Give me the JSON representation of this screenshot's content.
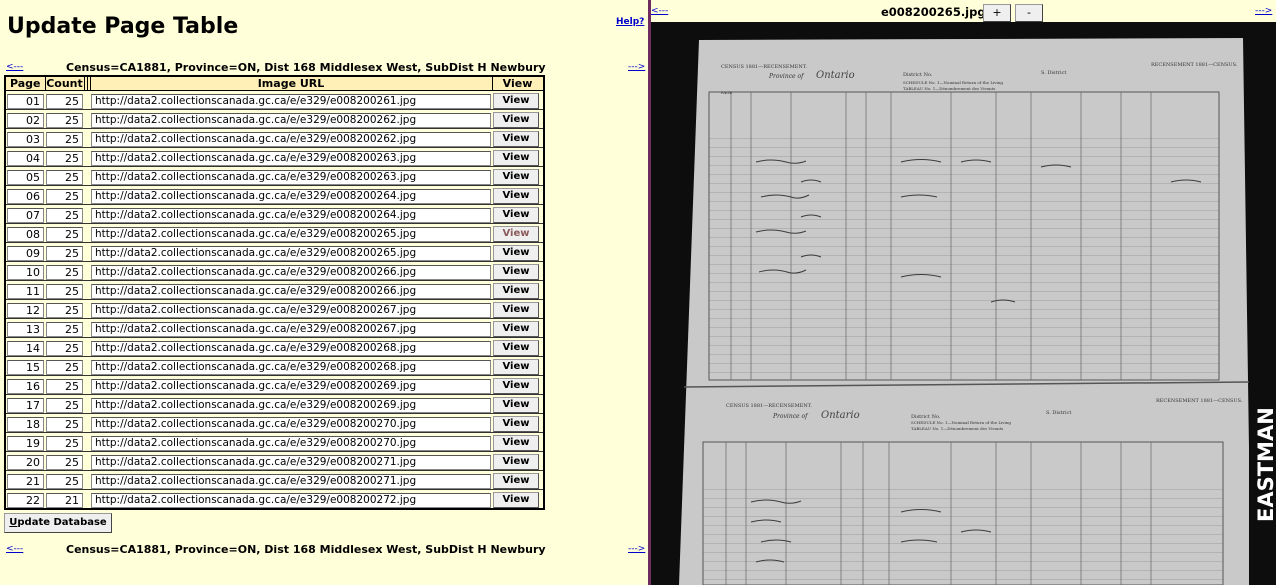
{
  "left": {
    "title": "Update Page Table",
    "help": "Help?",
    "prev": "<---",
    "next": "--->",
    "census": "Census=CA1881, Province=ON, Dist 168 Middlesex West, SubDist H Newbury",
    "headers": {
      "page": "Page",
      "count": "Count",
      "url": "Image URL",
      "view": "View"
    },
    "rows": [
      {
        "page": "01",
        "count": "25",
        "url": "http://data2.collectionscanada.gc.ca/e/e329/e008200261.jpg",
        "view": "View"
      },
      {
        "page": "02",
        "count": "25",
        "url": "http://data2.collectionscanada.gc.ca/e/e329/e008200262.jpg",
        "view": "View"
      },
      {
        "page": "03",
        "count": "25",
        "url": "http://data2.collectionscanada.gc.ca/e/e329/e008200262.jpg",
        "view": "View"
      },
      {
        "page": "04",
        "count": "25",
        "url": "http://data2.collectionscanada.gc.ca/e/e329/e008200263.jpg",
        "view": "View"
      },
      {
        "page": "05",
        "count": "25",
        "url": "http://data2.collectionscanada.gc.ca/e/e329/e008200263.jpg",
        "view": "View"
      },
      {
        "page": "06",
        "count": "25",
        "url": "http://data2.collectionscanada.gc.ca/e/e329/e008200264.jpg",
        "view": "View"
      },
      {
        "page": "07",
        "count": "25",
        "url": "http://data2.collectionscanada.gc.ca/e/e329/e008200264.jpg",
        "view": "View"
      },
      {
        "page": "08",
        "count": "25",
        "url": "http://data2.collectionscanada.gc.ca/e/e329/e008200265.jpg",
        "view": "View"
      },
      {
        "page": "09",
        "count": "25",
        "url": "http://data2.collectionscanada.gc.ca/e/e329/e008200265.jpg",
        "view": "View"
      },
      {
        "page": "10",
        "count": "25",
        "url": "http://data2.collectionscanada.gc.ca/e/e329/e008200266.jpg",
        "view": "View"
      },
      {
        "page": "11",
        "count": "25",
        "url": "http://data2.collectionscanada.gc.ca/e/e329/e008200266.jpg",
        "view": "View"
      },
      {
        "page": "12",
        "count": "25",
        "url": "http://data2.collectionscanada.gc.ca/e/e329/e008200267.jpg",
        "view": "View"
      },
      {
        "page": "13",
        "count": "25",
        "url": "http://data2.collectionscanada.gc.ca/e/e329/e008200267.jpg",
        "view": "View"
      },
      {
        "page": "14",
        "count": "25",
        "url": "http://data2.collectionscanada.gc.ca/e/e329/e008200268.jpg",
        "view": "View"
      },
      {
        "page": "15",
        "count": "25",
        "url": "http://data2.collectionscanada.gc.ca/e/e329/e008200268.jpg",
        "view": "View"
      },
      {
        "page": "16",
        "count": "25",
        "url": "http://data2.collectionscanada.gc.ca/e/e329/e008200269.jpg",
        "view": "View"
      },
      {
        "page": "17",
        "count": "25",
        "url": "http://data2.collectionscanada.gc.ca/e/e329/e008200269.jpg",
        "view": "View"
      },
      {
        "page": "18",
        "count": "25",
        "url": "http://data2.collectionscanada.gc.ca/e/e329/e008200270.jpg",
        "view": "View"
      },
      {
        "page": "19",
        "count": "25",
        "url": "http://data2.collectionscanada.gc.ca/e/e329/e008200270.jpg",
        "view": "View"
      },
      {
        "page": "20",
        "count": "25",
        "url": "http://data2.collectionscanada.gc.ca/e/e329/e008200271.jpg",
        "view": "View"
      },
      {
        "page": "21",
        "count": "25",
        "url": "http://data2.collectionscanada.gc.ca/e/e329/e008200271.jpg",
        "view": "View"
      },
      {
        "page": "22",
        "count": "21",
        "url": "http://data2.collectionscanada.gc.ca/e/e329/e008200272.jpg",
        "view": "View"
      }
    ],
    "active_row": "08",
    "update_button": {
      "accel": "U",
      "rest": "pdate Database"
    }
  },
  "right": {
    "prev": "<---",
    "next": "--->",
    "image_name": "e008200265.jpg",
    "zoom_in": "+",
    "zoom_out": "-",
    "scan": {
      "top_header_left": "CENSUS 1881—RECENSEMENT.",
      "top_header_right": "RECENSEMENT 1881—CENSUS.",
      "bottom_header_left": "CENSUS 1881—RECENSEMENT.",
      "bottom_header_right": "RECENSEMENT 1881—CENSUS.",
      "province_label": "Province of",
      "province_hand": "Ontario",
      "district_label": "District No.",
      "subdistrict_label": "S. District",
      "schedule_text": "SCHEDULE No. 1—Nominal Return of the Living",
      "tableau_text": "TABLEAU No. 1—Dénombrement des Vivants",
      "page_label": "PAGE",
      "watermark": "EASTMAN"
    }
  }
}
